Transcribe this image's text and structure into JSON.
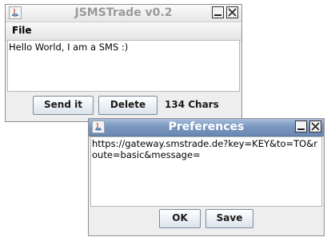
{
  "main_window": {
    "title": "JSMSTrade v0.2",
    "menu": {
      "file_label": "File"
    },
    "message_text": "Hello World, I am a SMS :)",
    "send_label": "Send it",
    "delete_label": "Delete",
    "char_count": "134 Chars"
  },
  "prefs_window": {
    "title": "Preferences",
    "url_text": "https://gateway.smstrade.de?key=KEY&to=TO&route=basic&message=",
    "ok_label": "OK",
    "save_label": "Save"
  }
}
